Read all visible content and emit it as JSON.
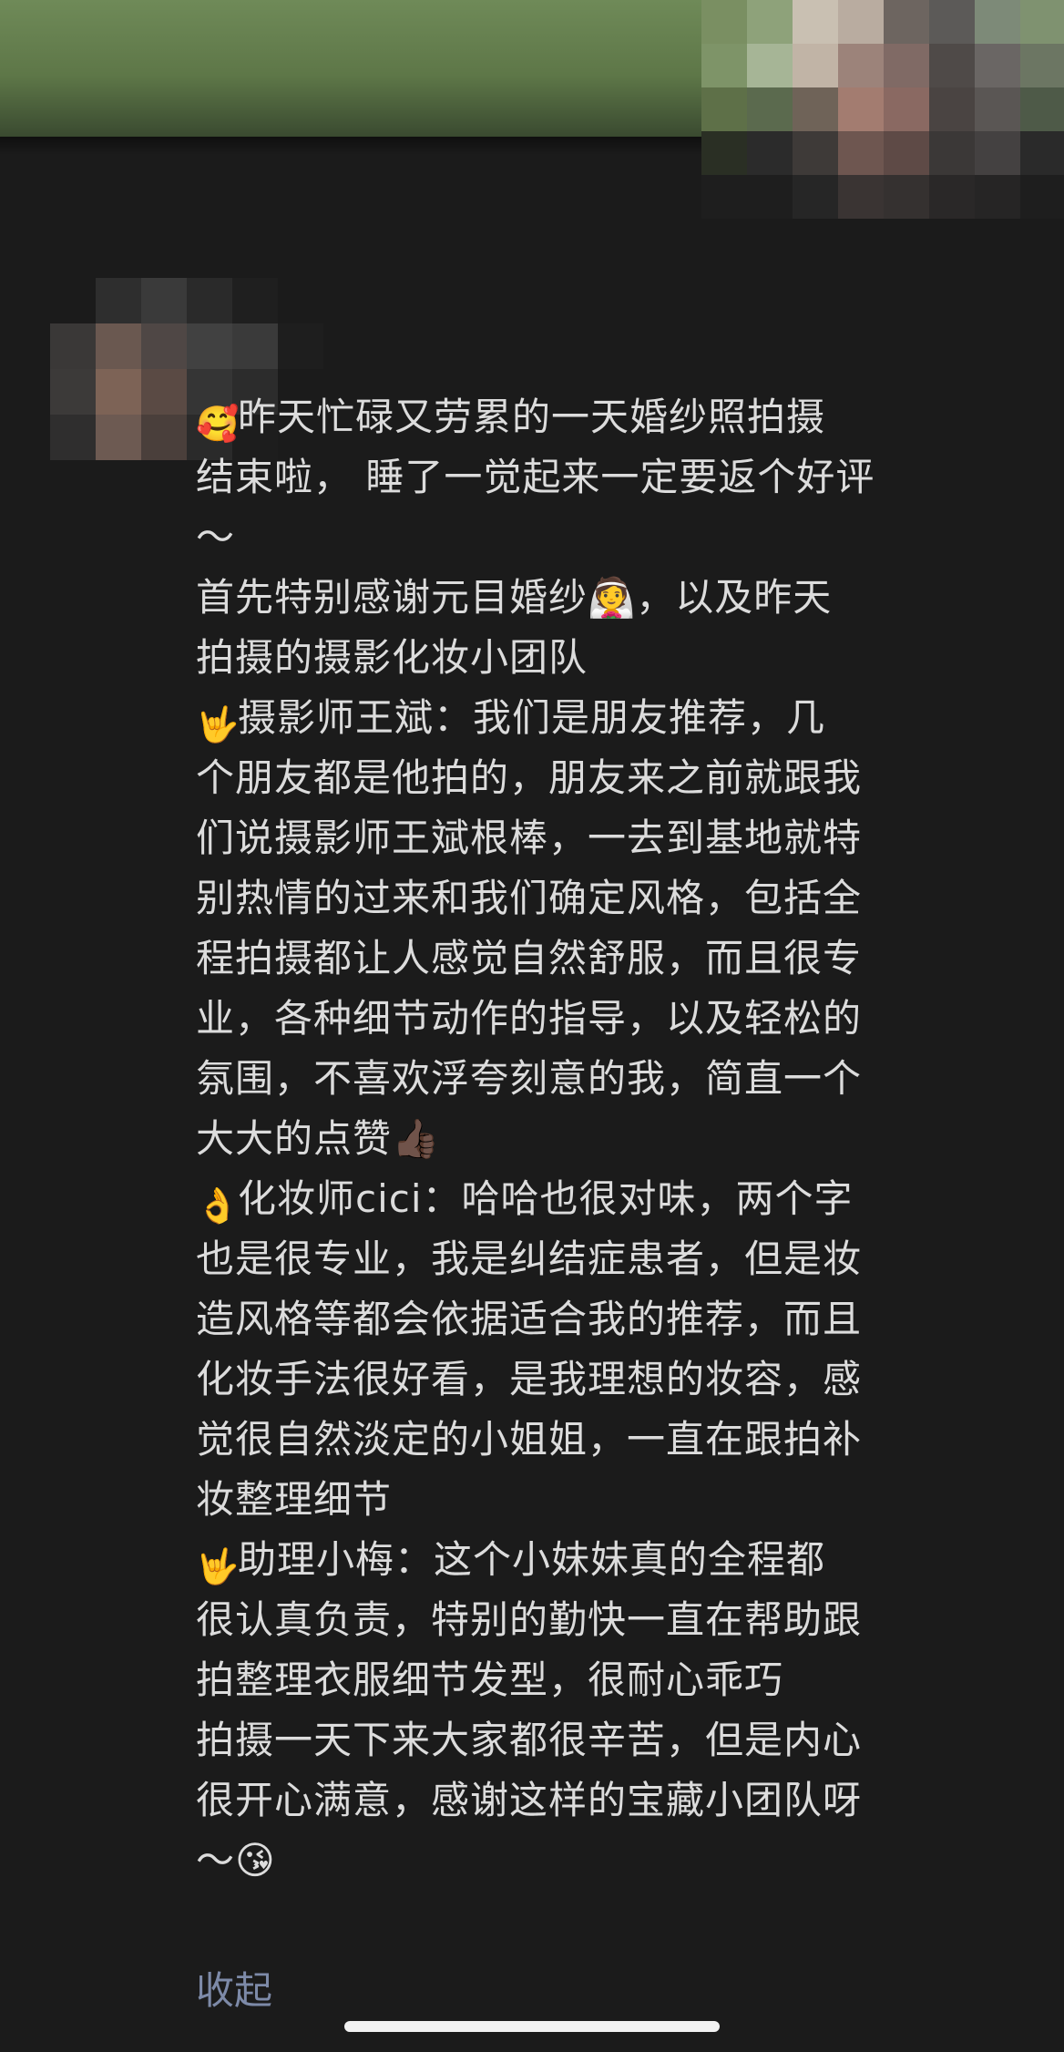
{
  "post": {
    "lines": [
      {
        "emoji": "smiling-face-with-hearts",
        "glyph": "🥰",
        "text": "昨天忙碌又劳累的一天婚纱照拍摄"
      },
      {
        "emoji": "",
        "glyph": "",
        "text": "结束啦， 睡了一觉起来一定要返个好评"
      },
      {
        "emoji": "",
        "glyph": "",
        "text": "～"
      },
      {
        "emoji": "",
        "glyph": "",
        "text": "首先特别感谢元目婚纱👰，以及昨天"
      },
      {
        "emoji": "",
        "glyph": "",
        "text": "拍摄的摄影化妆小团队"
      },
      {
        "emoji": "love-you-gesture",
        "glyph": "🤟",
        "text": "摄影师王斌：我们是朋友推荐，几"
      },
      {
        "emoji": "",
        "glyph": "",
        "text": "个朋友都是他拍的，朋友来之前就跟我"
      },
      {
        "emoji": "",
        "glyph": "",
        "text": "们说摄影师王斌根棒，一去到基地就特"
      },
      {
        "emoji": "",
        "glyph": "",
        "text": "别热情的过来和我们确定风格，包括全"
      },
      {
        "emoji": "",
        "glyph": "",
        "text": "程拍摄都让人感觉自然舒服，而且很专"
      },
      {
        "emoji": "",
        "glyph": "",
        "text": "业，各种细节动作的指导，以及轻松的"
      },
      {
        "emoji": "",
        "glyph": "",
        "text": "氛围，不喜欢浮夸刻意的我，简直一个"
      },
      {
        "emoji": "",
        "glyph": "",
        "text": "大大的点赞👍🏿"
      },
      {
        "emoji": "ok-hand",
        "glyph": "👌",
        "text": "化妆师cici：哈哈也很对味，两个字"
      },
      {
        "emoji": "",
        "glyph": "",
        "text": "也是很专业，我是纠结症患者，但是妆"
      },
      {
        "emoji": "",
        "glyph": "",
        "text": "造风格等都会依据适合我的推荐，而且"
      },
      {
        "emoji": "",
        "glyph": "",
        "text": "化妆手法很好看，是我理想的妆容，感"
      },
      {
        "emoji": "",
        "glyph": "",
        "text": "觉很自然淡定的小姐姐，一直在跟拍补"
      },
      {
        "emoji": "",
        "glyph": "",
        "text": "妆整理细节"
      },
      {
        "emoji": "love-you-gesture",
        "glyph": "🤟",
        "text": "助理小梅：这个小妹妹真的全程都"
      },
      {
        "emoji": "",
        "glyph": "",
        "text": "很认真负责，特别的勤快一直在帮助跟"
      },
      {
        "emoji": "",
        "glyph": "",
        "text": "拍整理衣服细节发型，很耐心乖巧"
      },
      {
        "emoji": "",
        "glyph": "",
        "text": "拍摄一天下来大家都很辛苦，但是内心"
      },
      {
        "emoji": "",
        "glyph": "",
        "text": "很开心满意，感谢这样的宝藏小团队呀"
      },
      {
        "emoji": "",
        "glyph": "",
        "text": "～😘"
      }
    ],
    "collapse_label": "收起"
  },
  "colors": {
    "background": "#1b1b1b",
    "text": "#dcdcdc",
    "link": "#7d8aa8",
    "banner": "#6f8a58"
  },
  "mosaic_top": [
    "#7a8f62",
    "#8ea27a",
    "#c9c0b2",
    "#b9aca0",
    "#6d6560",
    "#5c5a58",
    "#7d8a78",
    "#7f9270",
    "#7e9468",
    "#a6b596",
    "#c1b4a6",
    "#9c837a",
    "#806a65",
    "#4f4a48",
    "#6a6664",
    "#6c7663",
    "#5e7048",
    "#5b6a4e",
    "#6f6358",
    "#a37c70",
    "#8a6962",
    "#4a4442",
    "#5a5654",
    "#4e5a48",
    "#2a2f24",
    "#2b2b2b",
    "#3e3a38",
    "#6e5650",
    "#5e4a46",
    "#3b3837",
    "#444141",
    "#2a2a2a",
    "#1e1e1e",
    "#1e1e1e",
    "#262626",
    "#3a3433",
    "#353130",
    "#2a2828",
    "#262525",
    "#1e1e1e",
    "#1b1b1b",
    "#1b1b1b",
    "#1b1b1b",
    "#1b1b1b",
    "#1b1b1b",
    "#1b1b1b",
    "#1b1b1b",
    "#1b1b1b"
  ],
  "mosaic_left": [
    "#1b1b1b",
    "#2e2e2e",
    "#3a3a3a",
    "#2a2a2a",
    "#1f1f1f",
    "#1b1b1b",
    "#3a3837",
    "#6a5850",
    "#4f4745",
    "#414141",
    "#3a3a3a",
    "#1e1e1e",
    "#3c3a39",
    "#7d6356",
    "#5a4a44",
    "#353535",
    "#2c2c2c",
    "#1b1b1b",
    "#2f2e2e",
    "#6d5a52",
    "#4a3f3b",
    "#2a2a2a",
    "#1d1d1d",
    "#1b1b1b"
  ]
}
